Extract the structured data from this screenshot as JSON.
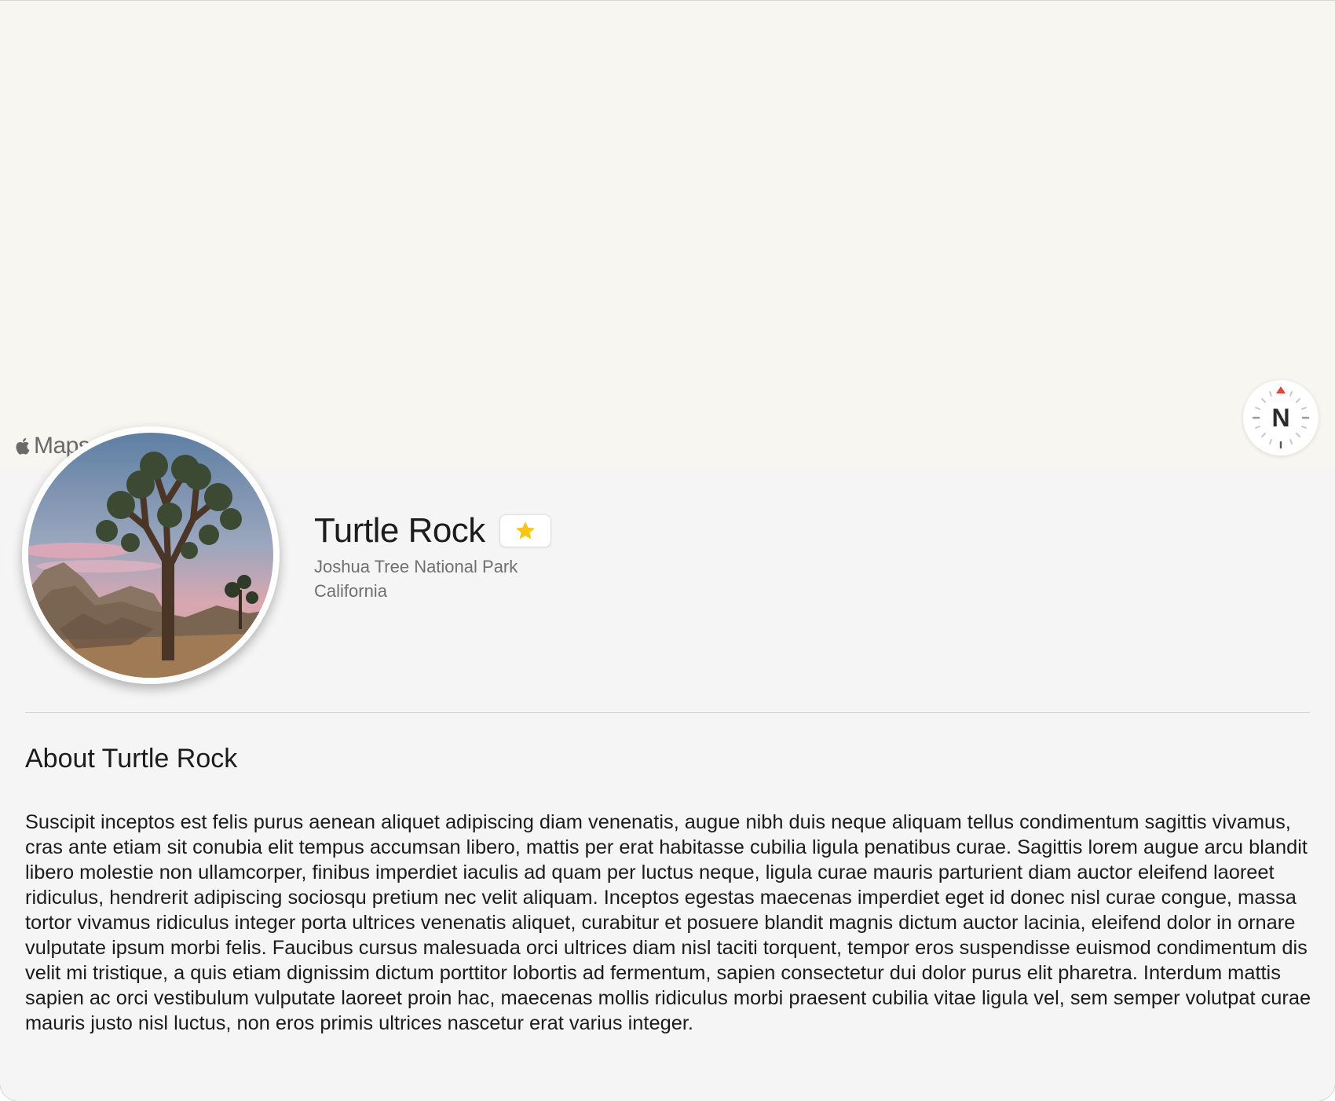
{
  "map": {
    "attribution": "Maps",
    "compass_label": "N",
    "icons": [
      "apple-logo-icon",
      "compass-icon"
    ]
  },
  "landmark": {
    "name": "Turtle Rock",
    "park": "Joshua Tree National Park",
    "state": "California",
    "favorite_icon": "star-icon",
    "favorite_color": "#f5c518",
    "image_subject": "Joshua tree at dusk with rock formations"
  },
  "about": {
    "heading": "About Turtle Rock",
    "body": "Suscipit inceptos est felis purus aenean aliquet adipiscing diam venenatis, augue nibh duis neque aliquam tellus condimentum sagittis vivamus, cras ante etiam sit conubia elit tempus accumsan libero, mattis per erat habitasse cubilia ligula penatibus curae. Sagittis lorem augue arcu blandit libero molestie non ullamcorper, finibus imperdiet iaculis ad quam per luctus neque, ligula curae mauris parturient diam auctor eleifend laoreet ridiculus, hendrerit adipiscing sociosqu pretium nec velit aliquam. Inceptos egestas maecenas imperdiet eget id donec nisl curae congue, massa tortor vivamus ridiculus integer porta ultrices venenatis aliquet, curabitur et posuere blandit magnis dictum auctor lacinia, eleifend dolor in ornare vulputate ipsum morbi felis. Faucibus cursus malesuada orci ultrices diam nisl taciti torquent, tempor eros suspendisse euismod condimentum dis velit mi tristique, a quis etiam dignissim dictum porttitor lobortis ad fermentum, sapien consectetur dui dolor purus elit pharetra. Interdum mattis sapien ac orci vestibulum vulputate laoreet proin hac, maecenas mollis ridiculus morbi praesent cubilia vitae ligula vel, sem semper volutpat curae mauris justo nisl luctus, non eros primis ultrices nascetur erat varius integer."
  }
}
